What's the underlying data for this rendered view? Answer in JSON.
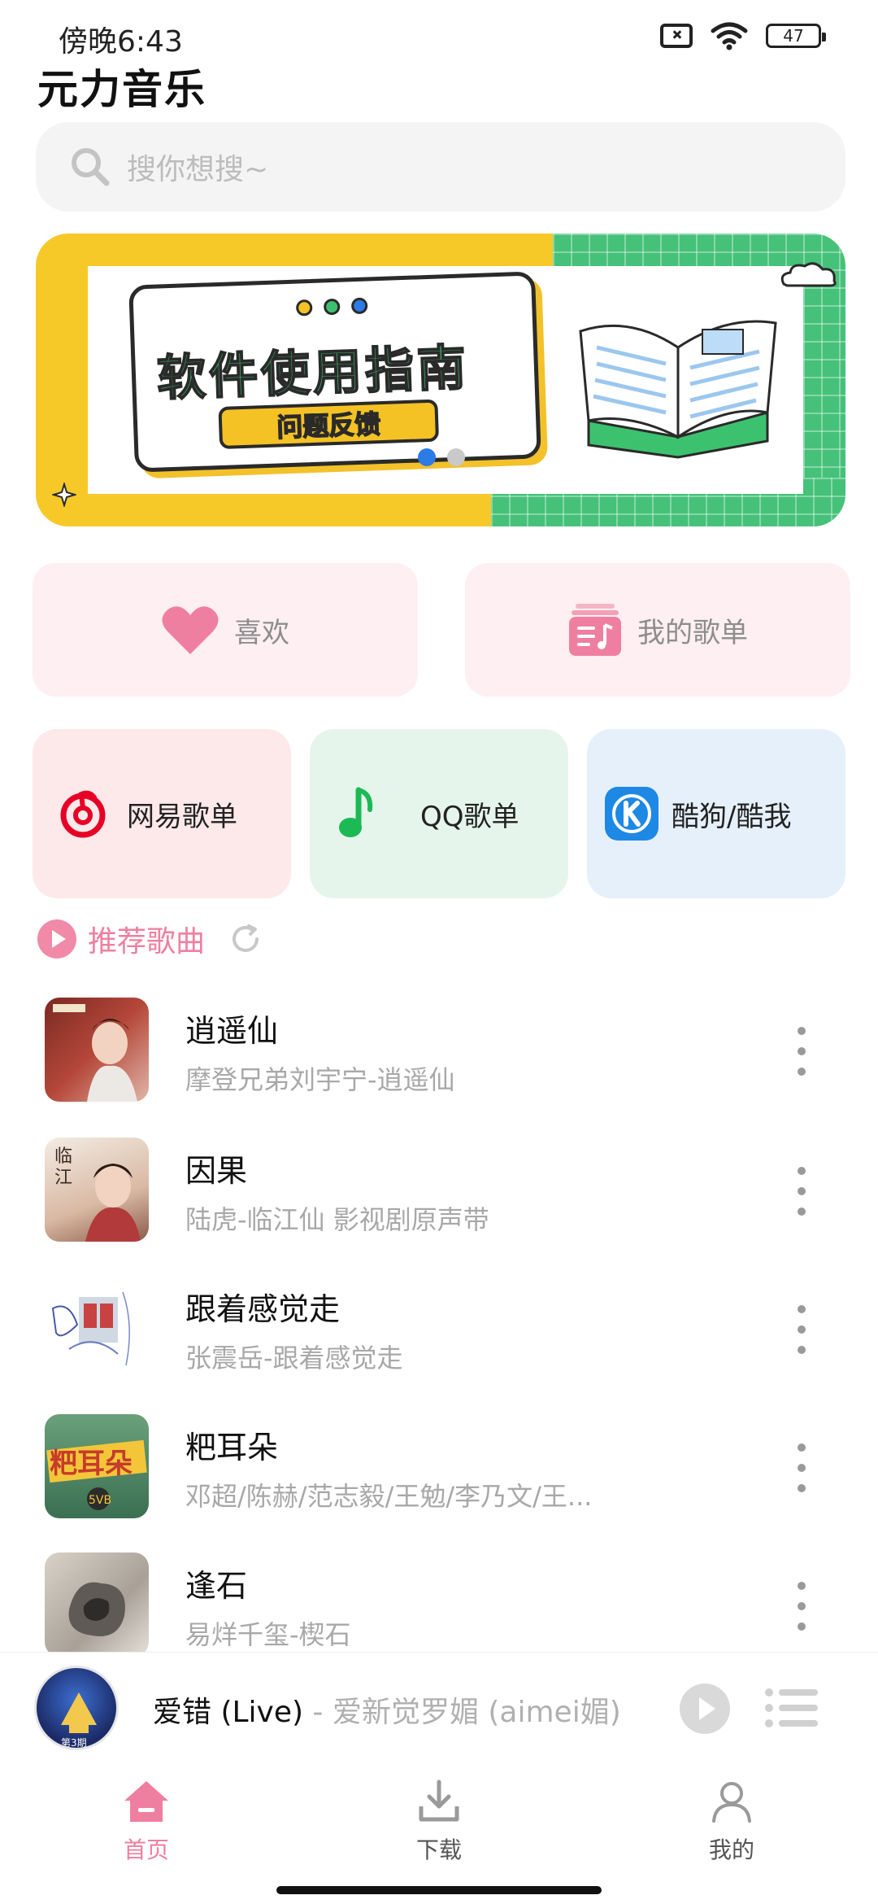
{
  "status_bar": {
    "time": "傍晚6:43",
    "battery": "47"
  },
  "app_title": "元力音乐",
  "search": {
    "placeholder": "搜你想搜~"
  },
  "banner": {
    "title": "软件使用指南",
    "button": "问题反馈",
    "indicator_count": 2,
    "active_index": 0
  },
  "quick_actions": [
    {
      "label": "喜欢",
      "icon": "heart-icon"
    },
    {
      "label": "我的歌单",
      "icon": "playlist-icon"
    }
  ],
  "sources": [
    {
      "label": "网易歌单",
      "icon": "netease-icon",
      "bg": "#fde8ea"
    },
    {
      "label": "QQ歌单",
      "icon": "qq-music-icon",
      "bg": "#e6f5ec"
    },
    {
      "label": "酷狗/酷我",
      "icon": "kugou-icon",
      "bg": "#e6f0fb"
    }
  ],
  "recommend": {
    "title": "推荐歌曲"
  },
  "songs": [
    {
      "title": "逍遥仙",
      "subtitle": "摩登兄弟刘宇宁-逍遥仙"
    },
    {
      "title": "因果",
      "subtitle": "陆虎-临江仙 影视剧原声带"
    },
    {
      "title": "跟着感觉走",
      "subtitle": "张震岳-跟着感觉走"
    },
    {
      "title": "粑耳朵",
      "subtitle": "邓超/陈赫/范志毅/王勉/李乃文/王..."
    },
    {
      "title": "逢石",
      "subtitle": "易烊千玺-楔石"
    }
  ],
  "now_playing": {
    "title": "爱错 (Live)",
    "separator": " - ",
    "artist": "爱新觉罗媚 (aimei媚)"
  },
  "nav": [
    {
      "label": "首页",
      "active": true
    },
    {
      "label": "下载",
      "active": false
    },
    {
      "label": "我的",
      "active": false
    }
  ],
  "colors": {
    "accent": "#ef7fa0",
    "netease_red": "#e60026",
    "qq_green": "#1db954",
    "kugou_blue": "#1e88e5"
  }
}
